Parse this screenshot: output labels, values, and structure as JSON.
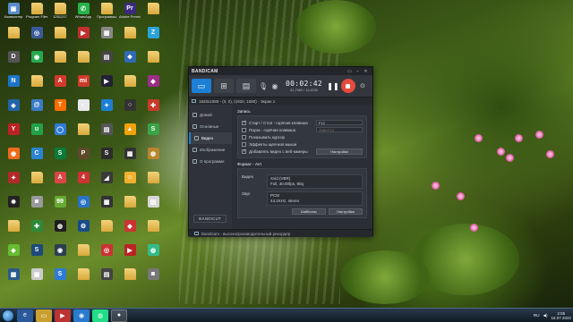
{
  "desktop": {
    "icons": [
      {
        "label": "Компьютер",
        "color": "#5a8ccc",
        "glyph": "▣"
      },
      {
        "label": "Program Files",
        "color": "folder",
        "glyph": ""
      },
      {
        "label": "1251217",
        "color": "folder",
        "glyph": ""
      },
      {
        "label": "WhatsApp",
        "color": "#25b34a",
        "glyph": "✆"
      },
      {
        "label": "Программы",
        "color": "folder",
        "glyph": ""
      },
      {
        "label": "Adobe Premiere Pro",
        "color": "#3a2c7a",
        "glyph": "Pr"
      },
      {
        "label": "",
        "color": "folder",
        "glyph": ""
      },
      {
        "label": "",
        "color": "folder",
        "glyph": ""
      },
      {
        "label": "",
        "color": "#3b5a9a",
        "glyph": "◎"
      },
      {
        "label": "",
        "color": "folder",
        "glyph": ""
      },
      {
        "label": "",
        "color": "#c03030",
        "glyph": "▶"
      },
      {
        "label": "",
        "color": "#888",
        "glyph": "▦"
      },
      {
        "label": "",
        "color": "folder",
        "glyph": ""
      },
      {
        "label": "",
        "color": "#2aa3d8",
        "glyph": "Z"
      },
      {
        "label": "",
        "color": "#555",
        "glyph": "D"
      },
      {
        "label": "",
        "color": "#27a94f",
        "glyph": "◉"
      },
      {
        "label": "",
        "color": "folder",
        "glyph": ""
      },
      {
        "label": "",
        "color": "folder",
        "glyph": ""
      },
      {
        "label": "",
        "color": "#444",
        "glyph": "▤"
      },
      {
        "label": "",
        "color": "#2f6ab3",
        "glyph": "❖"
      },
      {
        "label": "",
        "color": "folder",
        "glyph": ""
      },
      {
        "label": "",
        "color": "#1d75c9",
        "glyph": "N"
      },
      {
        "label": "",
        "color": "folder",
        "glyph": ""
      },
      {
        "label": "",
        "color": "#d3392b",
        "glyph": "A"
      },
      {
        "label": "",
        "color": "#cc3a2a",
        "glyph": "mi"
      },
      {
        "label": "",
        "color": "#223",
        "glyph": "▶"
      },
      {
        "label": "",
        "color": "folder",
        "glyph": ""
      },
      {
        "label": "",
        "color": "#9c2e86",
        "glyph": "◆"
      },
      {
        "label": "",
        "color": "#2264a8",
        "glyph": "◈"
      },
      {
        "label": "",
        "color": "#3a7bc8",
        "glyph": "@"
      },
      {
        "label": "",
        "color": "#ff6d00",
        "glyph": "T"
      },
      {
        "label": "",
        "color": "#e8eaed",
        "glyph": "◐"
      },
      {
        "label": "",
        "color": "#1c7fd6",
        "glyph": "✦"
      },
      {
        "label": "",
        "color": "#333",
        "glyph": "○"
      },
      {
        "label": "",
        "color": "#c73b2b",
        "glyph": "✚"
      },
      {
        "label": "",
        "color": "#b22",
        "glyph": "Y"
      },
      {
        "label": "",
        "color": "#24a148",
        "glyph": "ʊ"
      },
      {
        "label": "",
        "color": "#2d7bd6",
        "glyph": "◯"
      },
      {
        "label": "",
        "color": "folder",
        "glyph": ""
      },
      {
        "label": "",
        "color": "#555",
        "glyph": "▤"
      },
      {
        "label": "",
        "color": "#f0a20b",
        "glyph": "▲"
      },
      {
        "label": "",
        "color": "#3aa346",
        "glyph": "S"
      },
      {
        "label": "",
        "color": "#ed6b1a",
        "glyph": "◉"
      },
      {
        "label": "",
        "color": "#2a84d2",
        "glyph": "C"
      },
      {
        "label": "",
        "color": "#0a7a3a",
        "glyph": "S"
      },
      {
        "label": "",
        "color": "#5d4a2a",
        "glyph": "P"
      },
      {
        "label": "",
        "color": "#2d2d2d",
        "glyph": "S"
      },
      {
        "label": "",
        "color": "#333",
        "glyph": "▦"
      },
      {
        "label": "",
        "color": "#b7862e",
        "glyph": "◍"
      },
      {
        "label": "",
        "color": "#b12a2a",
        "glyph": "✦"
      },
      {
        "label": "",
        "color": "folder",
        "glyph": ""
      },
      {
        "label": "",
        "color": "#d44",
        "glyph": "A"
      },
      {
        "label": "",
        "color": "#c33",
        "glyph": "4"
      },
      {
        "label": "",
        "color": "#3a3a3a",
        "glyph": "◢"
      },
      {
        "label": "",
        "color": "#f0b030",
        "glyph": "☺"
      },
      {
        "label": "",
        "color": "folder",
        "glyph": ""
      },
      {
        "label": "",
        "color": "#222",
        "glyph": "✹"
      },
      {
        "label": "",
        "color": "#999",
        "glyph": "◙"
      },
      {
        "label": "",
        "color": "#6a3",
        "glyph": "99"
      },
      {
        "label": "",
        "color": "#2a73c9",
        "glyph": "◎"
      },
      {
        "label": "",
        "color": "#333",
        "glyph": "▩"
      },
      {
        "label": "",
        "color": "folder",
        "glyph": ""
      },
      {
        "label": "",
        "color": "#d7d7d7",
        "glyph": "▤"
      },
      {
        "label": "",
        "color": "folder",
        "glyph": ""
      },
      {
        "label": "",
        "color": "#2d8a3a",
        "glyph": "✚"
      },
      {
        "label": "",
        "color": "#1e1e1e",
        "glyph": "◍"
      },
      {
        "label": "",
        "color": "#1a4c8a",
        "glyph": "⚙"
      },
      {
        "label": "",
        "color": "folder",
        "glyph": ""
      },
      {
        "label": "",
        "color": "#c33",
        "glyph": "◆"
      },
      {
        "label": "",
        "color": "folder",
        "glyph": ""
      },
      {
        "label": "",
        "color": "#6b3",
        "glyph": "◈"
      },
      {
        "label": "",
        "color": "#1e4a7a",
        "glyph": "S"
      },
      {
        "label": "",
        "color": "#2c3e50",
        "glyph": "◉"
      },
      {
        "label": "",
        "color": "folder",
        "glyph": ""
      },
      {
        "label": "",
        "color": "#c33",
        "glyph": "◎"
      },
      {
        "label": "",
        "color": "#b22",
        "glyph": "▶"
      },
      {
        "label": "",
        "color": "#3b8",
        "glyph": "◍"
      },
      {
        "label": "",
        "color": "#2a5a8a",
        "glyph": "▦"
      },
      {
        "label": "",
        "color": "#ccc",
        "glyph": "▣"
      },
      {
        "label": "",
        "color": "#2d7bd6",
        "glyph": "S"
      },
      {
        "label": "",
        "color": "folder",
        "glyph": ""
      },
      {
        "label": "",
        "color": "#444",
        "glyph": "▤"
      },
      {
        "label": "",
        "color": "folder",
        "glyph": ""
      },
      {
        "label": "",
        "color": "#777",
        "glyph": "◙"
      }
    ]
  },
  "window": {
    "logo": "BANDICAM",
    "timer": "00:02:42",
    "size": "51,7MB / 14,0GB",
    "info": "1920x1080 - (0, 0), (1920, 1080) - Экран 1",
    "sidebar": [
      {
        "label": "Домой",
        "icon": "home-icon"
      },
      {
        "label": "Основные",
        "icon": "gear-icon"
      },
      {
        "label": "Видео",
        "icon": "video-icon"
      },
      {
        "label": "Изображение",
        "icon": "image-icon"
      },
      {
        "label": "О программе",
        "icon": "info-icon"
      }
    ],
    "sidebar_logo": "BANDICUT",
    "record_title": "Запись",
    "options": [
      {
        "label": "Старт / Стоп - горячая клавиша",
        "checked": true,
        "key": "F12",
        "dim": false
      },
      {
        "label": "Пауза - горячая клавиша",
        "checked": false,
        "key": "Shift+F12",
        "dim": true
      },
      {
        "label": "Показывать курсор",
        "checked": false,
        "key": "",
        "dim": false
      },
      {
        "label": "Эффекты щелчков мыши",
        "checked": false,
        "key": "",
        "dim": false
      },
      {
        "label": "Добавлять видео с веб-камеры",
        "checked": true,
        "key": "",
        "dim": false
      }
    ],
    "settings_label": "Настройки",
    "format_title": "Формат - AVI",
    "video_label": "Видео",
    "video_value_1": "Xvid (VBR)",
    "video_value_2": "Full, 30.00fps, 80q",
    "audio_label": "Звук",
    "audio_value_1": "PCM",
    "audio_value_2": "44,1KHz, stereo",
    "templates_label": "Шаблоны",
    "format_settings_label": "Настройки",
    "status": "Bandicam - высокопроизводительный рекордер"
  },
  "taskbar": {
    "lang": "RU",
    "time": "2:05",
    "date": "16.07.2022"
  },
  "colors": {
    "accent": "#1c7fd6",
    "record": "#e44b3a"
  }
}
